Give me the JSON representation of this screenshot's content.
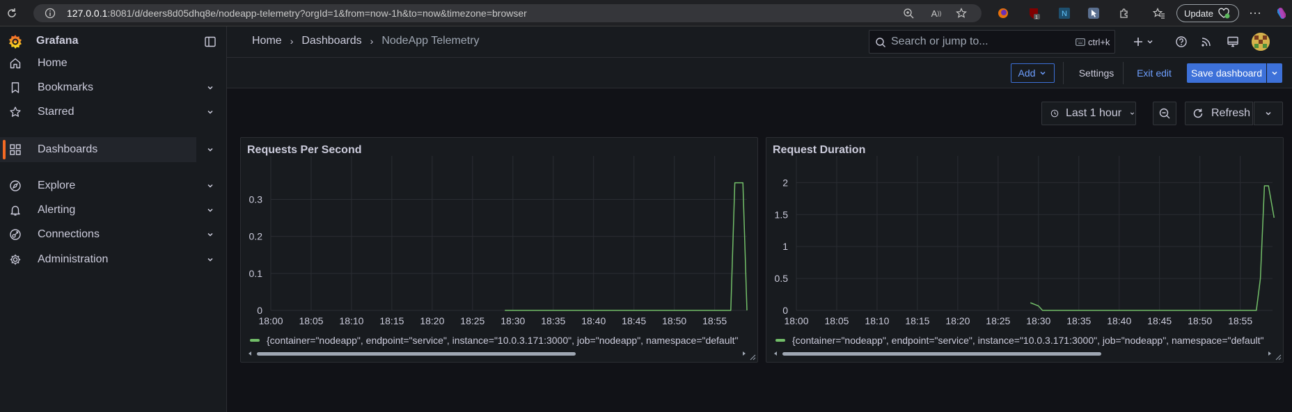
{
  "browser": {
    "url_host": "127.0.0.1",
    "url_rest": ":8081/d/deers8d05dhq8e/nodeapp-telemetry?orgId=1&from=now-1h&to=now&timezone=browser",
    "update_label": "Update"
  },
  "sidebar": {
    "brand": "Grafana",
    "items": [
      {
        "label": "Home",
        "icon": "home-icon",
        "expandable": false
      },
      {
        "label": "Bookmarks",
        "icon": "bookmark-icon",
        "expandable": true
      },
      {
        "label": "Starred",
        "icon": "star-icon",
        "expandable": true
      },
      {
        "label": "Dashboards",
        "icon": "dashboards-icon",
        "expandable": true,
        "active": true
      },
      {
        "label": "Explore",
        "icon": "compass-icon",
        "expandable": true
      },
      {
        "label": "Alerting",
        "icon": "bell-icon",
        "expandable": true
      },
      {
        "label": "Connections",
        "icon": "connections-icon",
        "expandable": true
      },
      {
        "label": "Administration",
        "icon": "gear-icon",
        "expandable": true
      }
    ]
  },
  "breadcrumb": {
    "home": "Home",
    "dashboards": "Dashboards",
    "current": "NodeApp Telemetry"
  },
  "search": {
    "placeholder": "Search or jump to...",
    "shortcut": "ctrl+k"
  },
  "toolbar": {
    "add_label": "Add",
    "settings_label": "Settings",
    "exit_edit_label": "Exit edit",
    "save_label": "Save dashboard"
  },
  "controls": {
    "time_range": "Last 1 hour",
    "refresh_label": "Refresh"
  },
  "colors": {
    "series": "#73bf69",
    "accent": "#3d71d9",
    "brand": "#f46a24"
  },
  "chart_data": [
    {
      "type": "line",
      "title": "Requests Per Second",
      "x_ticks": [
        "18:00",
        "18:05",
        "18:10",
        "18:15",
        "18:20",
        "18:25",
        "18:30",
        "18:35",
        "18:40",
        "18:45",
        "18:50",
        "18:55"
      ],
      "y_ticks": [
        "0",
        "0.1",
        "0.2",
        "0.3"
      ],
      "xlim": [
        "18:00",
        "18:59"
      ],
      "ylim": [
        0,
        0.38
      ],
      "grid": true,
      "legend_position": "bottom",
      "series": [
        {
          "name": "{container=\"nodeapp\", endpoint=\"service\", instance=\"10.0.3.171:3000\", job=\"nodeapp\", namespace=\"default\"",
          "x": [
            "18:29",
            "18:57",
            "18:57.5",
            "18:58.5",
            "18:59"
          ],
          "y": [
            0,
            0,
            0.345,
            0.345,
            0
          ]
        }
      ]
    },
    {
      "type": "line",
      "title": "Request Duration",
      "x_ticks": [
        "18:00",
        "18:05",
        "18:10",
        "18:15",
        "18:20",
        "18:25",
        "18:30",
        "18:35",
        "18:40",
        "18:45",
        "18:50",
        "18:55"
      ],
      "y_ticks": [
        "0",
        "0.5",
        "1",
        "1.5",
        "2"
      ],
      "xlim": [
        "18:00",
        "18:59"
      ],
      "ylim": [
        0,
        2.2
      ],
      "grid": true,
      "legend_position": "bottom",
      "series": [
        {
          "name": "{container=\"nodeapp\", endpoint=\"service\", instance=\"10.0.3.171:3000\", job=\"nodeapp\", namespace=\"default\"",
          "x": [
            "18:29",
            "18:30",
            "18:30.5",
            "18:57",
            "18:57.5",
            "18:58",
            "18:58.5",
            "18:59.2"
          ],
          "y": [
            0.12,
            0.07,
            0,
            0,
            0.5,
            1.95,
            1.95,
            1.45
          ]
        }
      ]
    }
  ]
}
